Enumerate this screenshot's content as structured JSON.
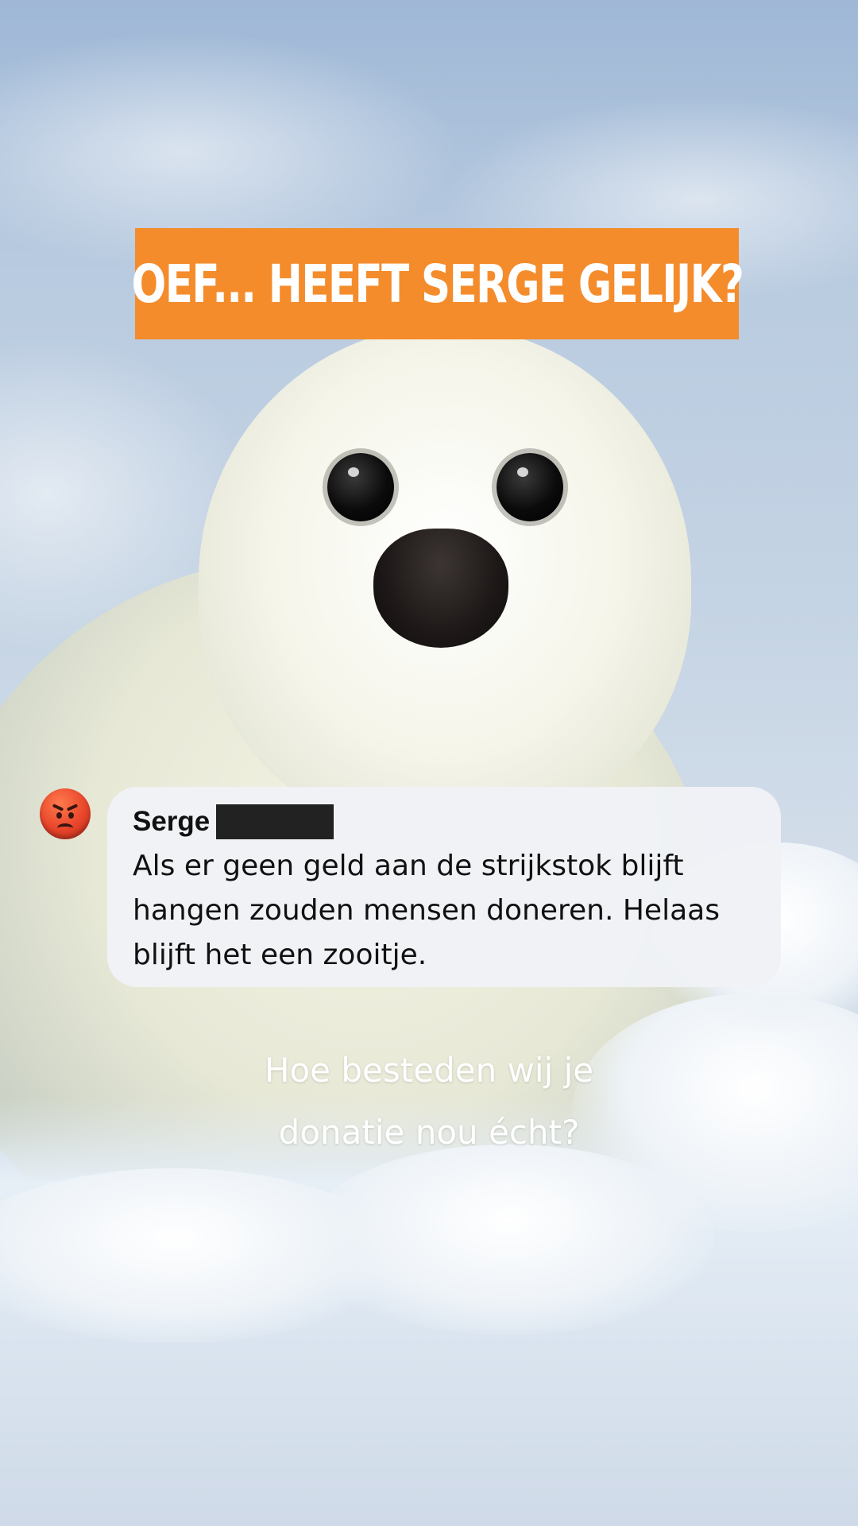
{
  "headline": "OEF... HEEFT SERGE GELIJK?",
  "comment": {
    "author": "Serge",
    "author_surname_redacted": true,
    "avatar_icon": "angry-face-emoji",
    "text": "Als er geen geld aan de strijkstok blijft hangen zouden mensen doneren. Helaas blijft het een zooitje."
  },
  "caption": {
    "line1": "Hoe besteden wij je",
    "line2": "donatie nou écht?"
  },
  "colors": {
    "banner": "#f48c2c",
    "bubble": "#f0f2f6",
    "caption": "#ffffff"
  },
  "background_image": "harp-seal-pup-on-snow"
}
